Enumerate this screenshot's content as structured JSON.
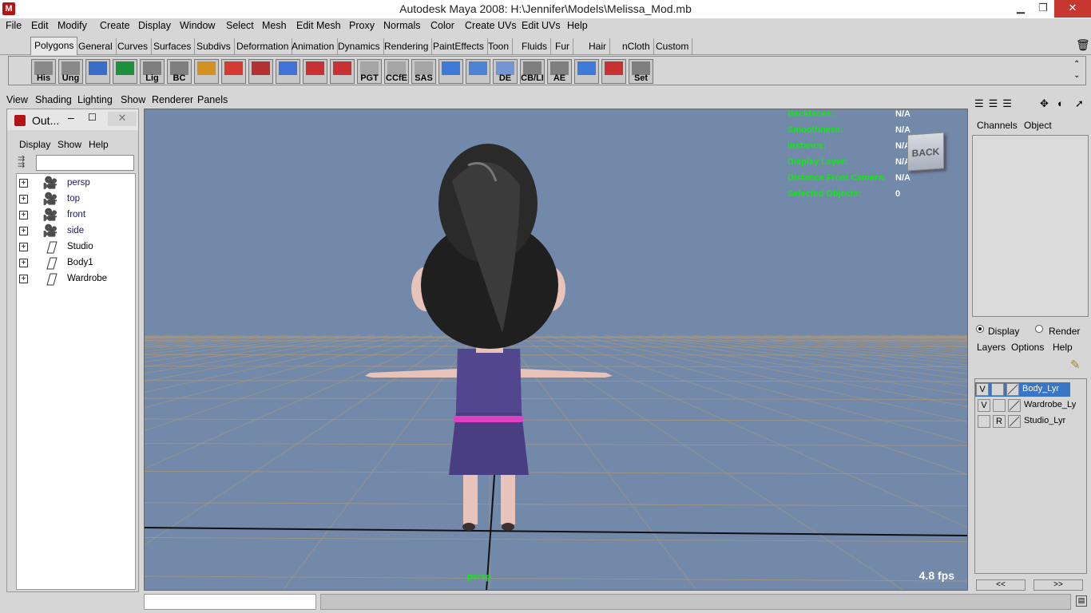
{
  "window": {
    "title": "Autodesk Maya 2008: H:\\Jennifer\\Models\\Melissa_Mod.mb",
    "app_icon": "maya-icon"
  },
  "menubar": {
    "items": [
      "File",
      "Edit",
      "Modify",
      "Create",
      "Display",
      "Window",
      "Select",
      "Mesh",
      "Edit Mesh",
      "Proxy",
      "Normals",
      "Color",
      "Create UVs",
      "Edit UVs",
      "Help"
    ]
  },
  "shelf": {
    "tabs": [
      "Polygons",
      "General",
      "Curves",
      "Surfaces",
      "Subdivs",
      "Deformation",
      "Animation",
      "Dynamics",
      "Rendering",
      "PaintEffects",
      "Toon",
      "Fluids",
      "Fur",
      "Hair",
      "nCloth",
      "Custom"
    ],
    "active_tab": "Polygons",
    "tools": [
      "His",
      "Ung",
      "",
      "",
      "Lig",
      "BC",
      "",
      "",
      "",
      "",
      "",
      "",
      "PGT",
      "CCfE",
      "SAS",
      "",
      "",
      "DE",
      "CB/LI",
      "AE",
      "",
      "",
      "Set"
    ]
  },
  "panel_menu": {
    "items": [
      "View",
      "Shading",
      "Lighting",
      "Show",
      "Renderer",
      "Panels"
    ]
  },
  "outliner": {
    "title": "Out...",
    "menu": [
      "Display",
      "Show",
      "Help"
    ],
    "items": [
      {
        "name": "persp",
        "kind": "camera"
      },
      {
        "name": "top",
        "kind": "camera"
      },
      {
        "name": "front",
        "kind": "camera"
      },
      {
        "name": "side",
        "kind": "camera"
      },
      {
        "name": "Studio",
        "kind": "geo"
      },
      {
        "name": "Body1",
        "kind": "geo"
      },
      {
        "name": "Wardrobe",
        "kind": "geo"
      }
    ]
  },
  "viewport": {
    "hud": [
      {
        "label": "Backfaces:",
        "value": "N/A"
      },
      {
        "label": "Smoothness:",
        "value": "N/A"
      },
      {
        "label": "Instance:",
        "value": "N/A"
      },
      {
        "label": "Display Layer:",
        "value": "N/A"
      },
      {
        "label": "Distance From Camera:",
        "value": "N/A"
      },
      {
        "label": "Selected Objects:",
        "value": "0"
      }
    ],
    "back_button": "BACK",
    "fps": "4.8 fps",
    "camera": "persp"
  },
  "channel_box": {
    "tabs": [
      "Channels",
      "Object"
    ]
  },
  "layer_editor": {
    "modes": [
      "Display",
      "Render"
    ],
    "selected_mode": "Display",
    "menu": [
      "Layers",
      "Options",
      "Help"
    ],
    "layers": [
      {
        "flag": "V",
        "name": "Body_Lyr",
        "selected": true
      },
      {
        "flag": "V",
        "name": "Wardrobe_Ly",
        "selected": false
      },
      {
        "flag": "R",
        "name": "Studio_Lyr",
        "selected": false
      }
    ],
    "scroll_left": "<<",
    "scroll_right": ">>"
  },
  "colors": {
    "viewport_bg": "#7289a9",
    "hud_label": "#12e812",
    "selection": "#3a74c4",
    "grid": "#b09a7a"
  }
}
